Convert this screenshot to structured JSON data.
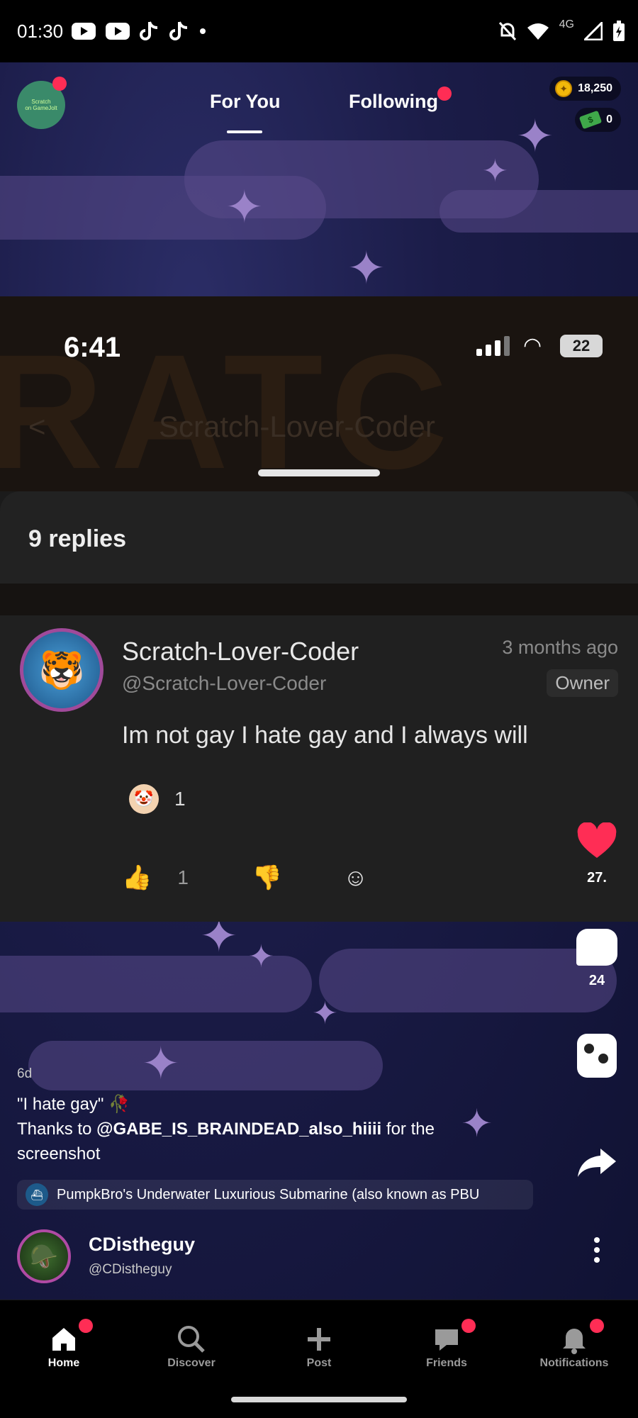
{
  "status_bar": {
    "time": "01:30",
    "network": "4G"
  },
  "topnav": {
    "tabs": [
      {
        "label": "For You",
        "active": true
      },
      {
        "label": "Following",
        "active": false,
        "has_dot": true
      }
    ],
    "coins": "18,250",
    "cash": "0"
  },
  "screenshot": {
    "phone_time": "6:41",
    "battery": "22",
    "page_title": "Scratch-Lover-Coder",
    "replies_label": "9 replies",
    "comment": {
      "name": "Scratch-Lover-Coder",
      "handle": "@Scratch-Lover-Coder",
      "time": "3 months ago",
      "badge": "Owner",
      "text": "Im not gay I hate gay and I always will",
      "reaction_count": "1",
      "like_count": "1"
    }
  },
  "rail": {
    "likes": "27.",
    "comments": "24"
  },
  "post": {
    "age": "6d",
    "caption_line1": "\"I hate gay\"",
    "caption_thanks": "Thanks to ",
    "caption_mention": "@GABE_IS_BRAINDEAD_also_hiiii",
    "caption_rest": " for the screenshot",
    "project": "PumpkBro's Underwater Luxurious Submarine (also known as PBU",
    "author_name": "CDistheguy",
    "author_handle": "@CDistheguy"
  },
  "bottom_nav": [
    {
      "label": "Home",
      "active": true
    },
    {
      "label": "Discover"
    },
    {
      "label": "Post"
    },
    {
      "label": "Friends"
    },
    {
      "label": "Notifications"
    }
  ],
  "colors": {
    "accent": "#ff2d55",
    "background": "#000000",
    "sheet": "#202020"
  }
}
